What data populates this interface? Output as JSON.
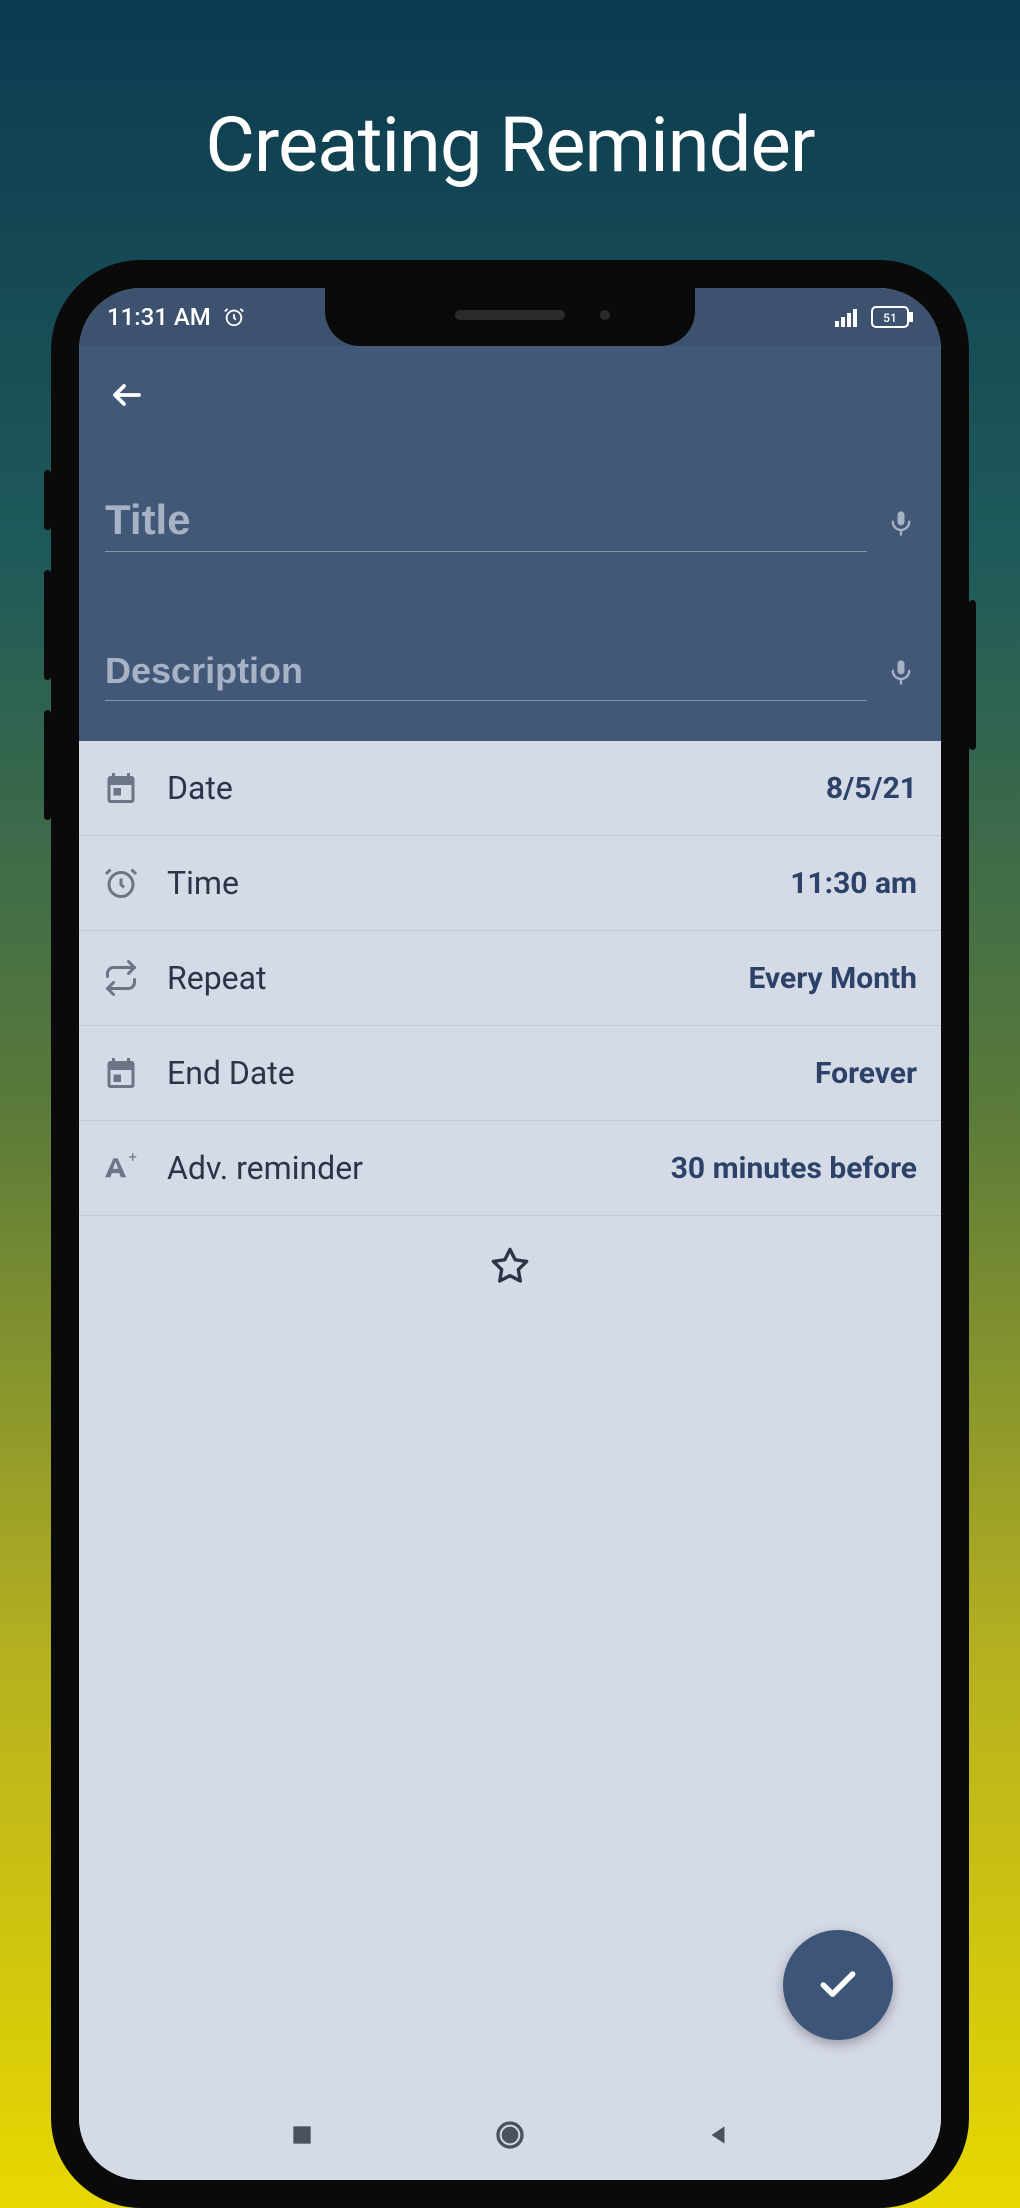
{
  "page_title": "Creating Reminder",
  "status_bar": {
    "time": "11:31 AM",
    "battery": "51"
  },
  "inputs": {
    "title_placeholder": "Title",
    "description_placeholder": "Description"
  },
  "settings": {
    "date": {
      "label": "Date",
      "value": "8/5/21"
    },
    "time": {
      "label": "Time",
      "value": "11:30 am"
    },
    "repeat": {
      "label": "Repeat",
      "value": "Every Month"
    },
    "end_date": {
      "label": "End Date",
      "value": "Forever"
    },
    "adv_reminder": {
      "label": "Adv. reminder",
      "value": "30 minutes before"
    }
  }
}
